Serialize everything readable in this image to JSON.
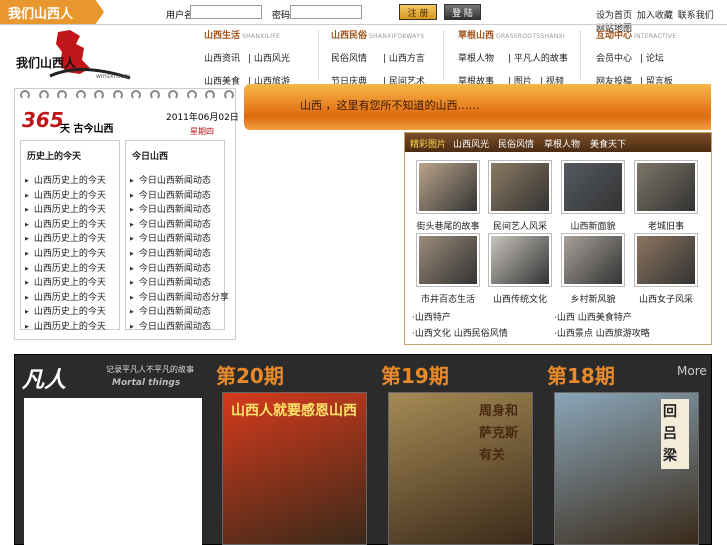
{
  "topbar": {
    "site_tag": "我们山西人",
    "username_label": "用户名：",
    "password_label": "密码：",
    "register_btn": "注 册",
    "login_btn": "登 陆",
    "links": [
      "设为首页",
      "加入收藏",
      "联系我们",
      "网站地图"
    ]
  },
  "logo": {
    "text": "我们山西人",
    "domain": "wmsxr.com"
  },
  "nav": [
    {
      "title": "山西生活",
      "subtitle": "SHANXILIFE",
      "row1": [
        "山西资讯",
        "| 山西风光"
      ],
      "row2": [
        "山西美食",
        "| 山西旅游"
      ]
    },
    {
      "title": "山西民俗",
      "subtitle": "SHANXIFOKWAYS",
      "row1": [
        "民俗风情",
        "| 山西方言"
      ],
      "row2": [
        "节日庆典",
        "| 民间艺术"
      ]
    },
    {
      "title": "草根山西",
      "subtitle": "GRASSROOTSSHANXI",
      "row1": [
        "草根人物",
        "| 平凡人的故事"
      ],
      "row2": [
        "草根故事",
        "| 图片",
        "| 视频"
      ]
    },
    {
      "title": "互动中心",
      "subtitle": "INTERACTIVE",
      "row1": [
        "会员中心",
        "| 论坛"
      ],
      "row2": [
        "网友投稿",
        "| 留言板"
      ]
    }
  ],
  "calendar": {
    "number": "365",
    "text": "天 古今山西",
    "date": "2011年06月02日",
    "sub": "星期四",
    "col1": {
      "title": "历史上的今天",
      "items": [
        "山西历史上的今天",
        "山西历史上的今天",
        "山西历史上的今天",
        "山西历史上的今天",
        "山西历史上的今天",
        "山西历史上的今天",
        "山西历史上的今天",
        "山西历史上的今天",
        "山西历史上的今天",
        "山西历史上的今天",
        "山西历史上的今天"
      ]
    },
    "col2": {
      "title": "今日山西",
      "items": [
        "今日山西新闻动态",
        "今日山西新闻动态",
        "今日山西新闻动态",
        "今日山西新闻动态",
        "今日山西新闻动态",
        "今日山西新闻动态",
        "今日山西新闻动态",
        "今日山西新闻动态",
        "今日山西新闻动态分享",
        "今日山西新闻动态",
        "今日山西新闻动态"
      ]
    }
  },
  "banner": {
    "text": "山西 ，这里有您所不知道的山西……"
  },
  "photos": {
    "tabs": [
      "精彩图片",
      "山西风光",
      "民俗风情",
      "草根人物",
      "美食天下"
    ],
    "thumbs": [
      {
        "caption": "街头巷尾的故事",
        "color": "#b9a58a"
      },
      {
        "caption": "民间艺人风采",
        "color": "#8b7a62"
      },
      {
        "caption": "山西新面貌",
        "color": "#555a60"
      },
      {
        "caption": "老城旧事",
        "color": "#7d7668"
      },
      {
        "caption": "市井百态生活",
        "color": "#9a8b7a"
      },
      {
        "caption": "山西传统文化",
        "color": "#c8c4bd"
      },
      {
        "caption": "乡村新风貌",
        "color": "#a7a19a"
      },
      {
        "caption": "山西女子风采",
        "color": "#8c7560"
      }
    ],
    "links": [
      "·山西特产",
      "·山西 山西美食特产",
      "·山西文化 山西民俗风情",
      "·山西景点 山西旅游攻略"
    ]
  },
  "feature": {
    "logo_text": "凡人",
    "logo_sub": "记录平凡人不平凡的故事",
    "logo_en": "Mortal things",
    "issues": [
      "第20期",
      "第19期",
      "第18期"
    ],
    "more": "More",
    "posters": [
      {
        "title": "山西人就要感恩山西",
        "color": "#d63a1c"
      },
      {
        "title": "周身和萨克斯有关",
        "color": "#a68a55"
      },
      {
        "title": "回吕梁",
        "color": "#8aa6b8"
      }
    ]
  }
}
